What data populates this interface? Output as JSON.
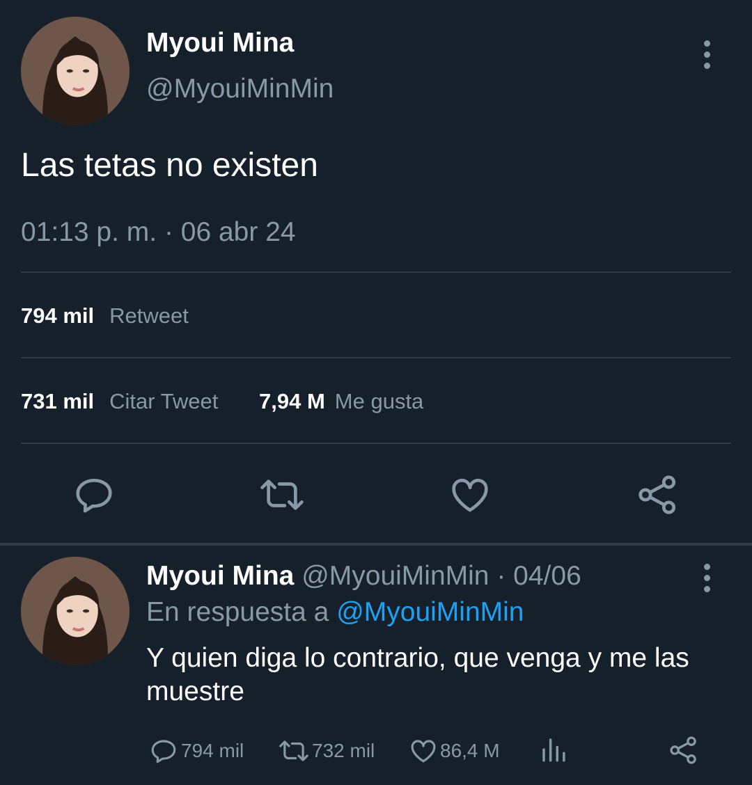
{
  "main_tweet": {
    "author_name": "Myoui Mina",
    "author_handle": "@MyouiMinMin",
    "text": "Las tetas no existen",
    "timestamp": "01:13 p. m. · 06 abr 24",
    "retweets": {
      "count": "794 mil",
      "label": "Retweet"
    },
    "quotes": {
      "count": "731 mil",
      "label": "Citar Tweet"
    },
    "likes": {
      "count": "7,94 M",
      "label": "Me gusta"
    },
    "actions": [
      "reply-icon",
      "retweet-icon",
      "like-icon",
      "share-icon"
    ]
  },
  "reply_tweet": {
    "author_name": "Myoui Mina",
    "author_handle": "@MyouiMinMin",
    "date": "· 04/06",
    "reply_prefix": "En respuesta a",
    "reply_to": "@MyouiMinMin",
    "text": "Y quien diga lo contrario, que venga y me las muestre",
    "reply_count": "794 mil",
    "retweet_count": "732 mil",
    "like_count": "86,4 M"
  },
  "colors": {
    "background": "#16202b",
    "text": "#ffffff",
    "muted": "#8899a6",
    "accent": "#1da1f2",
    "divider": "#2f3b47"
  }
}
